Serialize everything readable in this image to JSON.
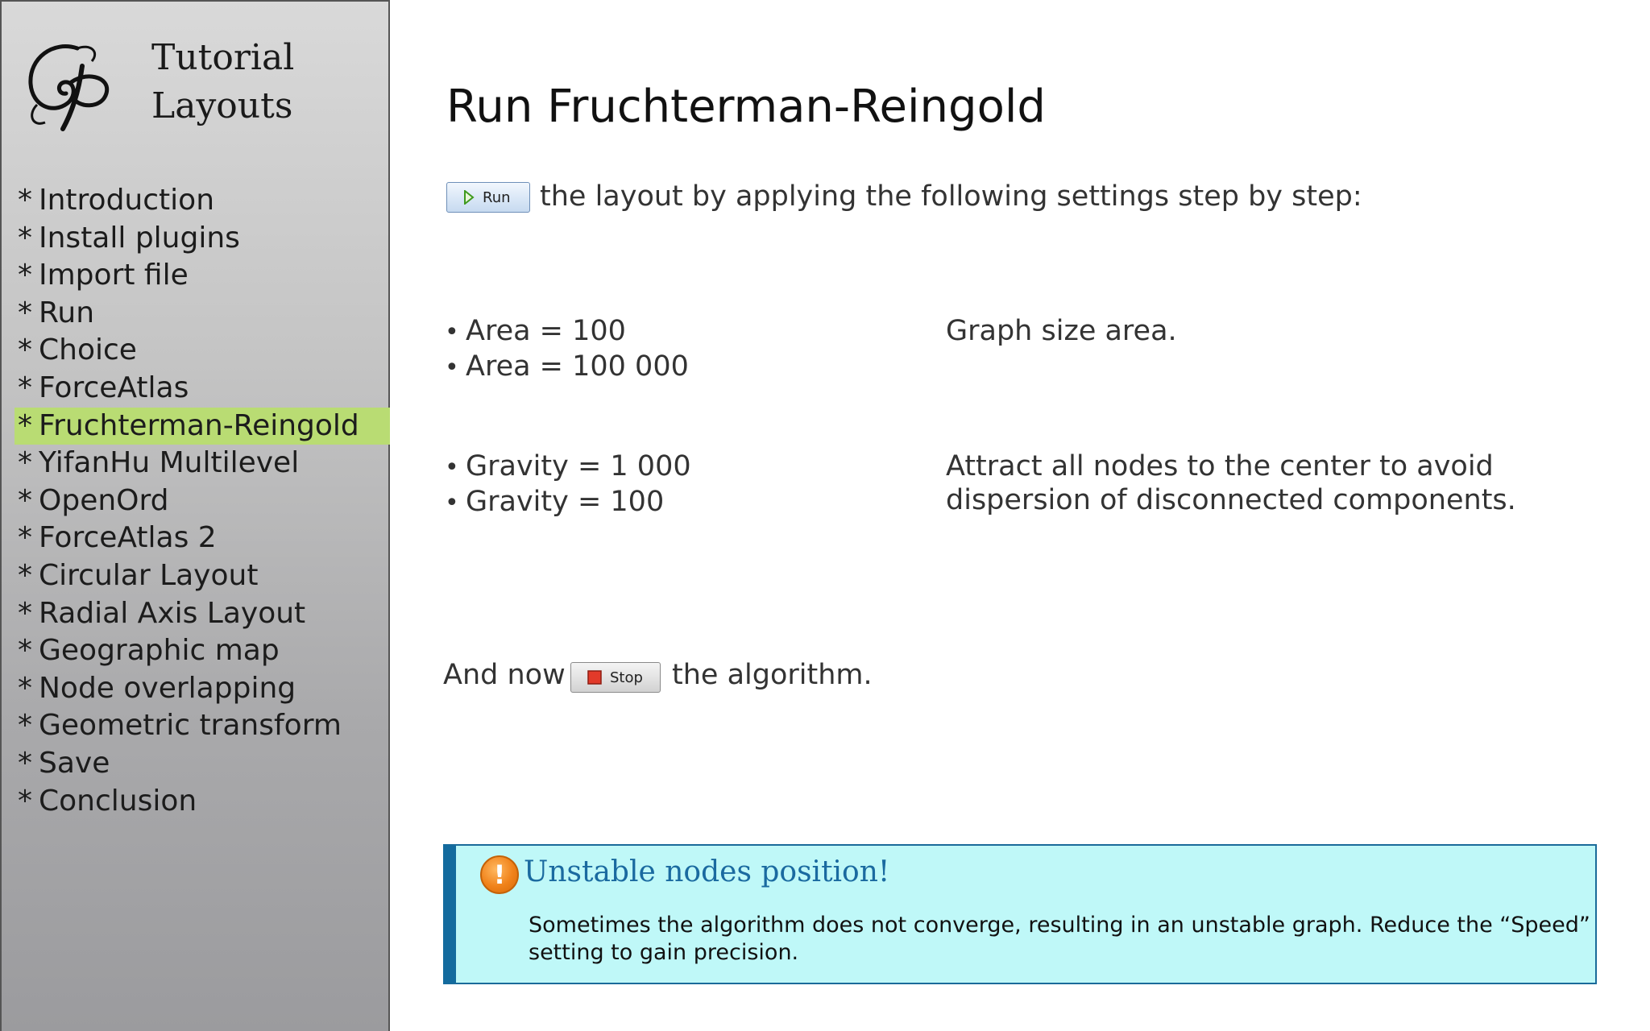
{
  "sidebar": {
    "title_line1": "Tutorial",
    "title_line2": "Layouts",
    "items": [
      {
        "label": "Introduction",
        "active": false
      },
      {
        "label": "Install plugins",
        "active": false
      },
      {
        "label": "Import file",
        "active": false
      },
      {
        "label": "Run",
        "active": false
      },
      {
        "label": "Choice",
        "active": false
      },
      {
        "label": "ForceAtlas",
        "active": false
      },
      {
        "label": "Fruchterman-Reingold",
        "active": true
      },
      {
        "label": "YifanHu Multilevel",
        "active": false
      },
      {
        "label": "OpenOrd",
        "active": false
      },
      {
        "label": "ForceAtlas 2",
        "active": false
      },
      {
        "label": "Circular Layout",
        "active": false
      },
      {
        "label": "Radial Axis Layout",
        "active": false
      },
      {
        "label": "Geographic map",
        "active": false
      },
      {
        "label": "Node overlapping",
        "active": false
      },
      {
        "label": "Geometric transform",
        "active": false
      },
      {
        "label": "Save",
        "active": false
      },
      {
        "label": "Conclusion",
        "active": false
      }
    ],
    "active_color": "#b9dc73"
  },
  "main": {
    "title": "Run Fruchterman-Reingold",
    "run_button": "Run",
    "run_text": "the layout by applying the following settings step by step:",
    "area_settings": [
      "Area = 100",
      "Area = 100 000"
    ],
    "area_desc": "Graph size area.",
    "gravity_settings": [
      "Gravity = 1 000",
      "Gravity = 100"
    ],
    "gravity_desc": "Attract all nodes to the center to avoid dispersion of disconnected components.",
    "and_now": "And now",
    "stop_button": "Stop",
    "algo_text": "the algorithm."
  },
  "callout": {
    "icon": "warning-icon",
    "title": "Unstable nodes position!",
    "body": "Sometimes the algorithm does not converge, resulting in an unstable graph. Reduce the “Speed” setting to gain precision.",
    "bg_color": "#bff8f8",
    "border_color": "#136b9e"
  }
}
